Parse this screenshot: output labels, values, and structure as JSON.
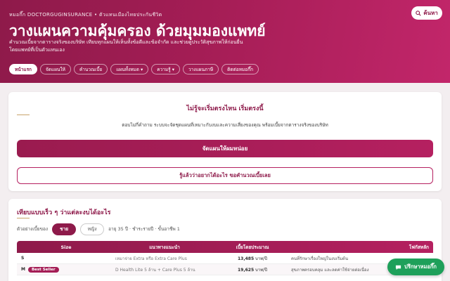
{
  "header": {
    "eyebrow": "หมอกึ๊ก DOCTORGUGINSURANCE • ตัวแทนเมืองไทยประกันชีวิต",
    "search_label": "ค้นหา",
    "title": "วางแผนความคุ้มครอง ด้วยมุมมองแพทย์",
    "description": "คำนวณเบี้ยจากตารางจริงของบริษัท เทียบทุกแผนให้เห็นทั้งข้อดีและข้อจำกัด และช่วยดูประวัติสุขภาพให้ก่อนยื่นโดยแพทย์ที่เป็นตัวแทนเอง"
  },
  "nav": {
    "items": [
      {
        "label": "หน้าแรก",
        "active": true
      },
      {
        "label": "จัดแผนให้",
        "active": false
      },
      {
        "label": "คำนวณเบี้ย",
        "active": false
      },
      {
        "label": "แผนทั้งหมด ▾",
        "active": false
      },
      {
        "label": "ความรู้ ▾",
        "active": false
      },
      {
        "label": "วางแผนภาษี",
        "active": false
      },
      {
        "label": "ติดต่อหมอกึ๊ก",
        "active": false
      }
    ]
  },
  "start": {
    "title": "ไม่รู้จะเริ่มตรงไหน เริ่มตรงนี้",
    "description": "ตอบไม่กี่คำถาม ระบบจะจัดชุดแผนที่เหมาะกับงบและความเสี่ยงของคุณ พร้อมเบี้ยจากตารางจริงของบริษัท",
    "primary_label": "จัดแผนให้ผมหน่อย",
    "secondary_label": "รู้แล้วว่าอยากได้อะไร ขอคำนวณเบี้ยเลย"
  },
  "compare": {
    "title": "เทียบแบบเร็ว ๆ ว่าแต่ละงบได้อะไร",
    "example_label": "ตัวอย่างเบี้ยของ",
    "male_label": "ชาย",
    "female_label": "หญิง",
    "age_info": "อายุ 35 ปี · ชำระรายปี · ขั้นอาชีพ 1",
    "columns": [
      "Size",
      "แนวทางแนะนำ",
      "เบี้ยโดยประมาณ",
      "โฟกัสหลัก"
    ],
    "rows": [
      {
        "size": "S",
        "badge": "",
        "plan": "เหมาจ่าย Extra หรือ Extra Care Plus",
        "premium": "13,485",
        "unit": "บาท/ปี",
        "focus": "คนที่รักษาเรื่องใหญ่ในงบเริ่มต้น"
      },
      {
        "size": "M",
        "badge": "Best Seller",
        "plan": "D Health Lite 5 ล้าน + Care Plus 5 ล้าน",
        "premium": "19,625",
        "unit": "บาท/ปี",
        "focus": "สุขภาพครอบคลุม และลดค่าใช้จ่ายต่อเนื่อง"
      }
    ]
  },
  "chat": {
    "label": "ปรึกษาหมอกึ๊ก"
  },
  "colors": {
    "brand": "#8e1a4a",
    "accent": "#b52060",
    "chat": "#1ea05a"
  }
}
